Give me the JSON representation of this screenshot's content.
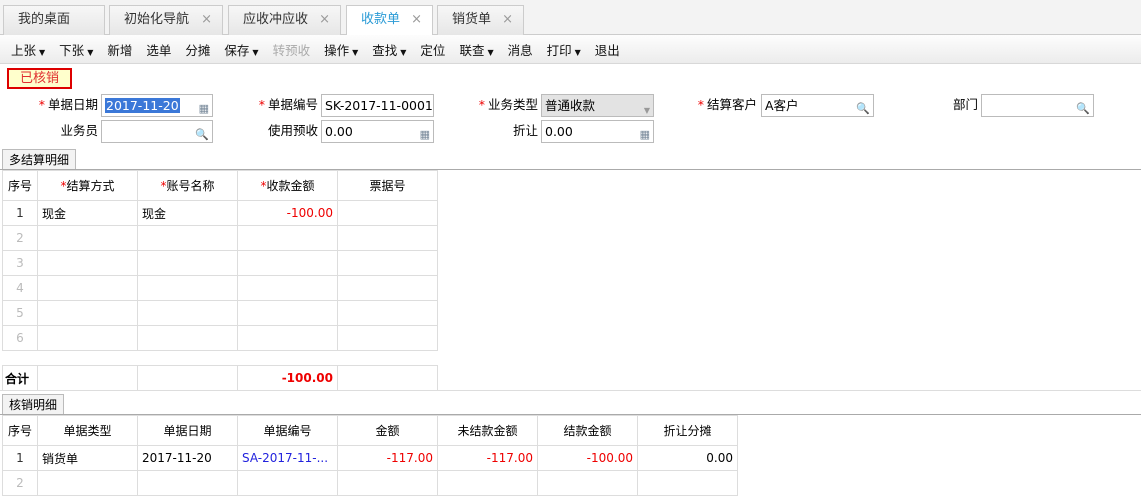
{
  "tabs": [
    {
      "label": "我的桌面"
    },
    {
      "label": "初始化导航",
      "close": "×"
    },
    {
      "label": "应收冲应收",
      "close": "×"
    },
    {
      "label": "收款单",
      "close": "×"
    },
    {
      "label": "销货单",
      "close": "×"
    }
  ],
  "toolbar": [
    {
      "label": "上张",
      "dd": "▼"
    },
    {
      "label": "下张",
      "dd": "▼"
    },
    {
      "label": "新增"
    },
    {
      "label": "选单"
    },
    {
      "label": "分摊"
    },
    {
      "label": "保存",
      "dd": "▼"
    },
    {
      "label": "转预收"
    },
    {
      "label": "操作",
      "dd": "▼"
    },
    {
      "label": "查找",
      "dd": "▼"
    },
    {
      "label": "定位"
    },
    {
      "label": "联查",
      "dd": "▼"
    },
    {
      "label": "消息"
    },
    {
      "label": "打印",
      "dd": "▼"
    },
    {
      "label": "退出"
    }
  ],
  "status": "已核销",
  "form": {
    "required_mark": "*",
    "date_label": "单据日期",
    "date": "2017-11-20",
    "no_label": "单据编号",
    "no": "SK-2017-11-0001",
    "type_label": "业务类型",
    "type": "普通收款",
    "customer_label": "结算客户",
    "customer": "A客户",
    "dept_label": "部门",
    "dept": "",
    "staff_label": "业务员",
    "staff": "",
    "prepay_label": "使用预收",
    "prepay": "0.00",
    "discount_label": "折让",
    "discount": "0.00"
  },
  "settle": {
    "tab": "多结算明细",
    "headers": [
      "序号",
      "结算方式",
      "账号名称",
      "收款金额",
      "票据号"
    ],
    "rows": [
      [
        "1",
        "现金",
        "现金",
        "-100.00",
        ""
      ],
      [
        "2",
        "",
        "",
        "",
        ""
      ],
      [
        "3",
        "",
        "",
        "",
        ""
      ],
      [
        "4",
        "",
        "",
        "",
        ""
      ],
      [
        "5",
        "",
        "",
        "",
        ""
      ],
      [
        "6",
        "",
        "",
        "",
        ""
      ]
    ],
    "total_label": "合计",
    "total": "-100.00"
  },
  "verify": {
    "tab": "核销明细",
    "headers": [
      "序号",
      "单据类型",
      "单据日期",
      "单据编号",
      "金额",
      "未结款金额",
      "结款金额",
      "折让分摊"
    ],
    "rows": [
      [
        "1",
        "销货单",
        "2017-11-20",
        "SA-2017-11-...",
        "-117.00",
        "-117.00",
        "-100.00",
        "0.00"
      ],
      [
        "2",
        "",
        "",
        "",
        "",
        "",
        "",
        ""
      ]
    ]
  }
}
